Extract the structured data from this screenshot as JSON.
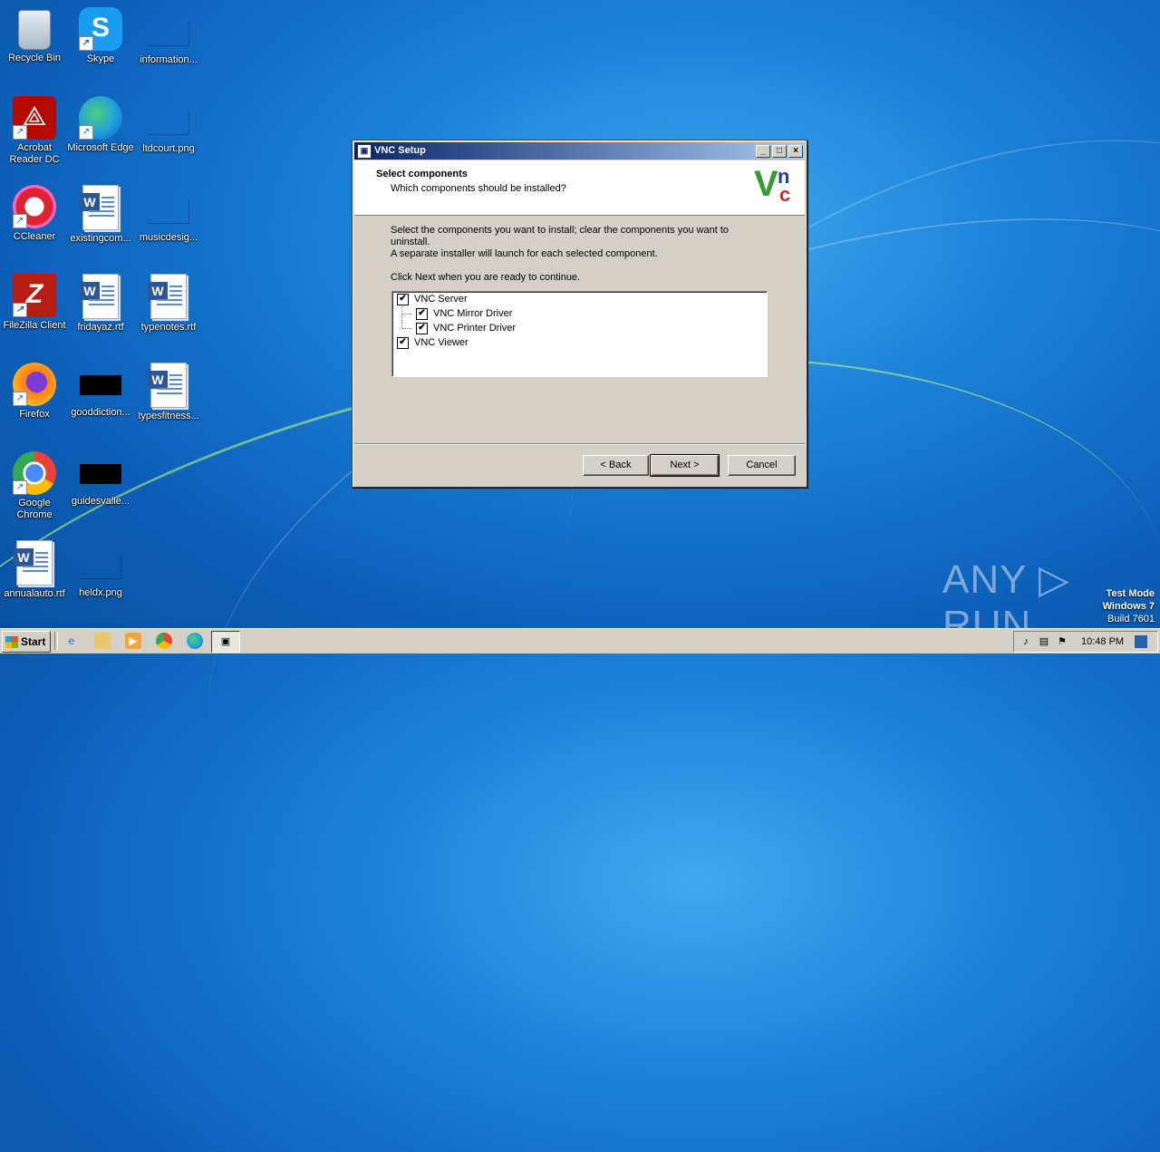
{
  "desktop": {
    "icons": [
      {
        "label": "Recycle Bin"
      },
      {
        "label": "Skype"
      },
      {
        "label": "information..."
      },
      {
        "label": "Acrobat Reader DC"
      },
      {
        "label": "Microsoft Edge"
      },
      {
        "label": "ltdcourt.png"
      },
      {
        "label": "CCleaner"
      },
      {
        "label": "existingcom..."
      },
      {
        "label": "musicdesig..."
      },
      {
        "label": "FileZilla Client"
      },
      {
        "label": "fridayaz.rtf"
      },
      {
        "label": "typenotes.rtf"
      },
      {
        "label": "Firefox"
      },
      {
        "label": "gooddiction..."
      },
      {
        "label": "typesfitness..."
      },
      {
        "label": "Google Chrome"
      },
      {
        "label": "guidesvalle..."
      },
      {
        "label": "annualauto.rtf"
      },
      {
        "label": "heldx.png"
      }
    ]
  },
  "window": {
    "title": "VNC Setup",
    "controls": {
      "minimize": "_",
      "maximize": "□",
      "close": "×"
    },
    "header": {
      "title": "Select components",
      "subtitle": "Which components should be installed?",
      "logo": {
        "v": "V",
        "n": "n",
        "c": "c"
      }
    },
    "instructions": {
      "line1": "Select the components you want to install; clear the components you want to",
      "line2": "uninstall.",
      "line3": "A separate installer will launch for each selected component.",
      "line4": "Click Next when you are ready to continue."
    },
    "components": [
      {
        "label": "VNC Server",
        "checked": true
      },
      {
        "label": "VNC Mirror Driver",
        "checked": true
      },
      {
        "label": "VNC Printer Driver",
        "checked": true
      },
      {
        "label": "VNC Viewer",
        "checked": true
      }
    ],
    "check_mark": "✔",
    "buttons": {
      "back": "< Back",
      "next": "Next >",
      "cancel": "Cancel"
    }
  },
  "watermark": "ANY ▷ RUN",
  "test_mode": {
    "line1": "Test Mode",
    "line2": "Windows 7",
    "line3": "Build 7601"
  },
  "taskbar": {
    "start_label": "Start",
    "clock": "10:48 PM"
  }
}
